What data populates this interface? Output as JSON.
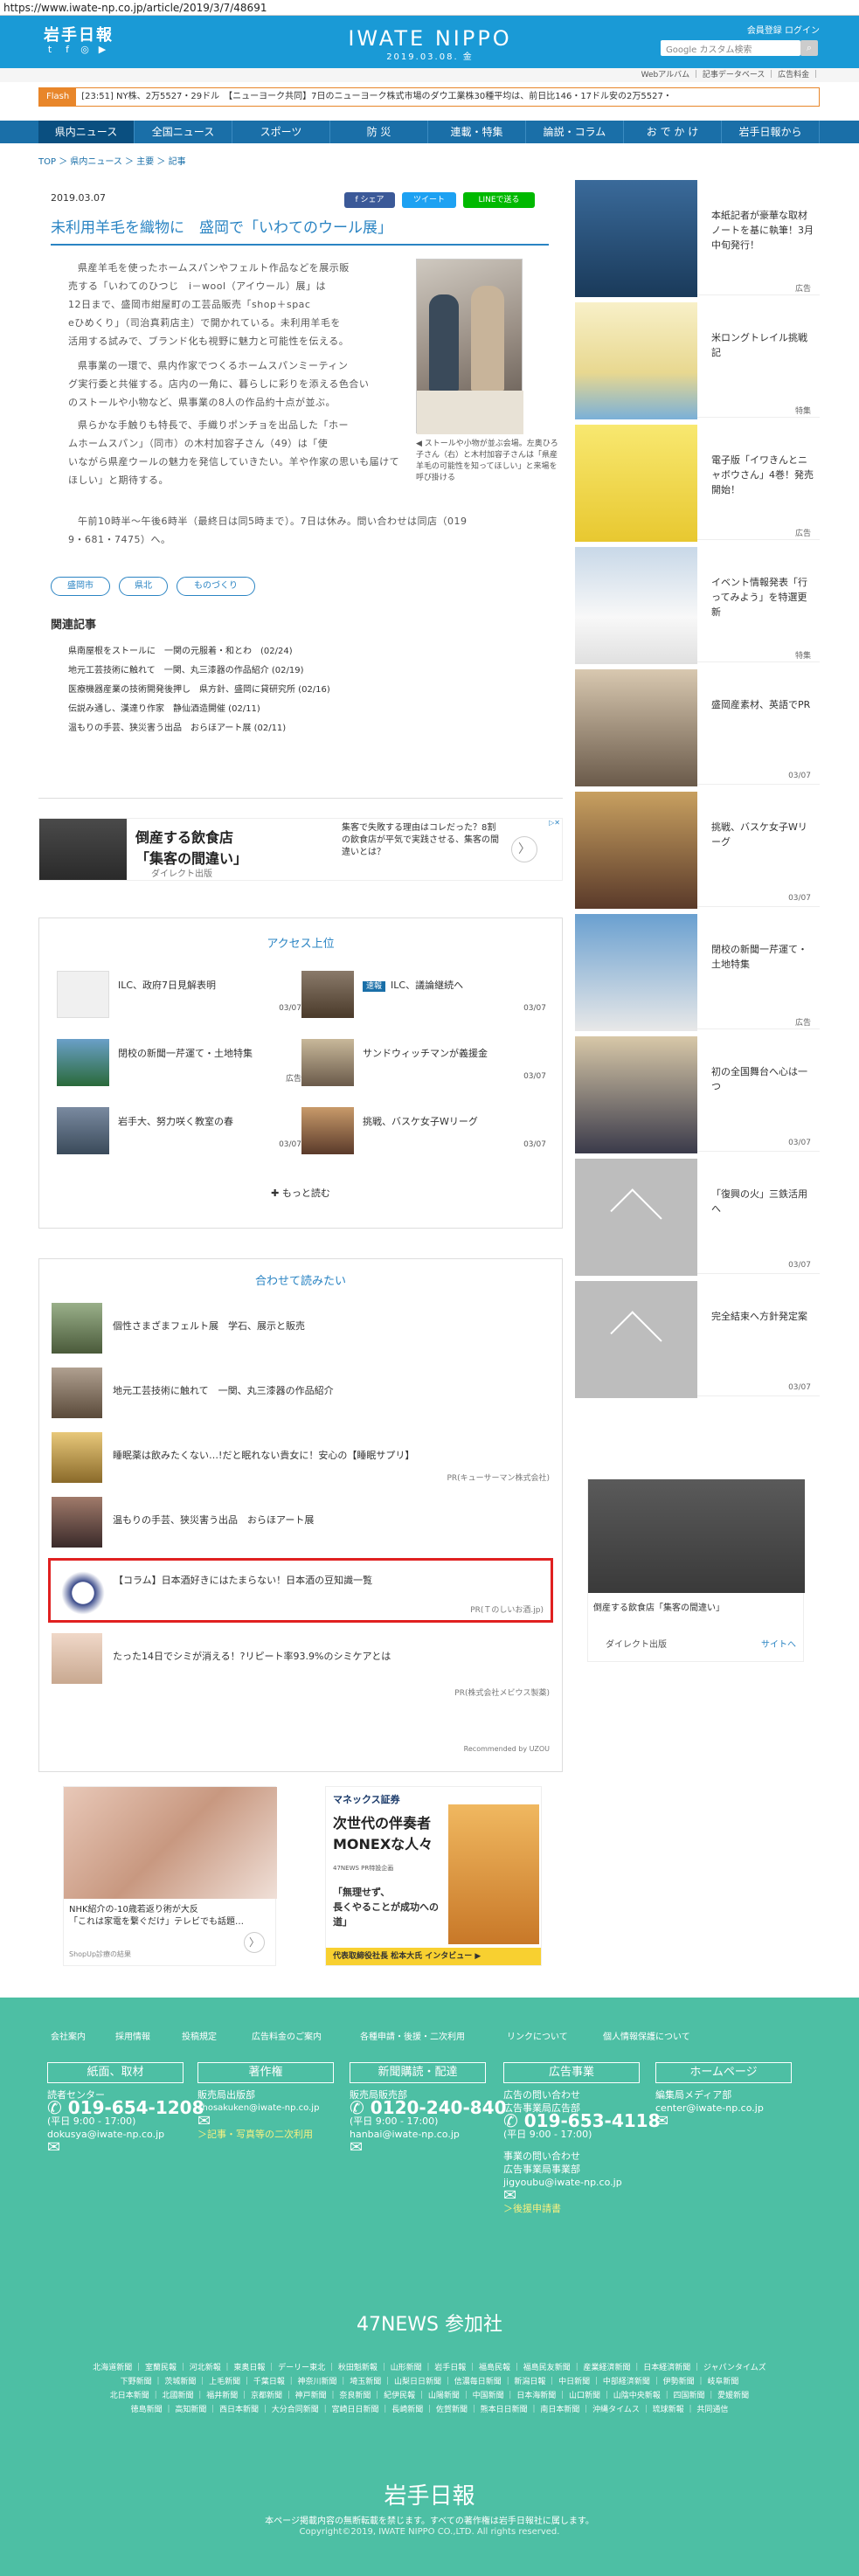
{
  "url": "https://www.iwate-np.co.jp/article/2019/3/7/48691",
  "header": {
    "logo": "岩手日報",
    "brand": "IWATE NIPPO",
    "date": "2019.03.08. 金",
    "member_links": "会員登録 ログイン",
    "search_placeholder": "Google カスタム検索",
    "search_icon": "search-icon",
    "sub_links": "Webアルバム ｜ 記事データベース ｜ 広告料金 ｜"
  },
  "flash": {
    "tag": "Flash",
    "text": "[23:51] NY株、2万5527・29ドル　【ニューヨーク共同】7日のニューヨーク株式市場のダウ工業株30種平均は、前日比146・17ドル安の2万5527・"
  },
  "nav": [
    "県内ニュース",
    "全国ニュース",
    "スポーツ",
    "防 災",
    "連載・特集",
    "論説・コラム",
    "お で か け",
    "岩手日報から"
  ],
  "breadcrumb": "TOP ＞ 県内ニュース ＞ 主要 ＞ 記事",
  "article": {
    "date": "2019.03.07",
    "share": {
      "facebook": "f シェア",
      "twitter": "ツイート",
      "line": "LINEで送る"
    },
    "title": "未利用羊毛を織物に　盛岡で「いわてのウール展」",
    "p1_lines": [
      "県産羊毛を使ったホームスパンやフェルト作品などを展示販",
      "売する「いわてのひつじ　i－wool（アイウール）展」は",
      "12日まで、盛岡市紺屋町の工芸品販売「shop＋spac",
      "eひめくり」（司治真莉店主）で開かれている。未利用羊毛を",
      "活用する試みで、ブランド化も視野に魅力と可能性を伝える。"
    ],
    "p2_lines": [
      "県事業の一環で、県内作家でつくるホームスパンミーティン",
      "グ実行委と共催する。店内の一角に、暮らしに彩りを添える色合い",
      "のストールや小物など、県事業の8人の作品約十点が並ぶ。"
    ],
    "p3_lines": [
      "県らかな手触りも特長で、手織りポンチョを出品した「ホー",
      "ムホームスパン」（同市）の木村加容子さん（49）は「使",
      "いながら県産ウールの魅力を発信していきたい。羊や作家の思いも届けて",
      "ほしい」と期待する。"
    ],
    "p4_lines": [
      "午前10時半～午後6時半（最終日は同5時まで）。7日は休み。問い合わせは同店（019",
      "9・681・7475）へ。"
    ],
    "caption": "◀ ストールや小物が並ぶ会場。左奥ひろ子さん（右）と木村加容子さんは「県産羊毛の可能性を知ってほしい」と来場を呼び掛ける",
    "tags": [
      "盛岡市",
      "県北",
      "ものづくり"
    ],
    "related_title": "関連記事",
    "related": [
      "県南屋根をストールに　一関の元服着・和とわ　(02/24)",
      "地元工芸技術に触れて　一関、丸三漆器の作品紹介 (02/19)",
      "医療機器産業の技術開発後押し　県方針、盛岡に貸研究所 (02/16)",
      "伝説み通し、漢達り作家　静仙酒造開催 (02/11)",
      "温もりの手芸、狭災害う出品　おらほアート展 (02/11)"
    ]
  },
  "ad_banner": {
    "headline_line1": "倒産する飲食店",
    "headline_line2": "「集客の間違い」",
    "sponsor": "ダイレクト出版",
    "desc": "集客で失敗する理由はコレだった？8割の飲食店が平気で実践させる、集客の間違いとは？",
    "next": "〉",
    "badge": "▷✕"
  },
  "ranking": {
    "title": "アクセス上位",
    "items": [
      {
        "text": "ILC、政府7日見解表明",
        "date": "03/07",
        "badge": ""
      },
      {
        "text": "ILC、議論継続へ",
        "date": "03/07",
        "badge": "速報"
      },
      {
        "text": "閉校の新聞一芹運て・土地特集",
        "date": "",
        "badge": "広告"
      },
      {
        "text": "サンドウィッチマンが義援金",
        "date": "03/07",
        "badge": ""
      },
      {
        "text": "岩手大、努力咲く教室の春",
        "date": "03/07",
        "badge": ""
      },
      {
        "text": "挑戦、バスケ女子Wリーグ",
        "date": "03/07",
        "badge": ""
      }
    ],
    "more": "もっと読む"
  },
  "recommend": {
    "title": "合わせて読みたい",
    "items": [
      {
        "text": "個性さまざまフェルト展　学石、展示と販売",
        "sponsor": ""
      },
      {
        "text": "地元工芸技術に触れて　一関、丸三漆器の作品紹介",
        "sponsor": ""
      },
      {
        "text": "睡眠薬は飲みたくない…!だと眠れない貴女に！安心の【睡眠サプリ】",
        "sponsor": "PR(キューサーマン株式会社)"
      },
      {
        "text": "温もりの手芸、狭災害う出品　おらほアート展",
        "sponsor": ""
      },
      {
        "text": "【コラム】日本酒好きにはたまらない！日本酒の豆知識一覧",
        "sponsor": "PR(Ｔのしいお酒.jp)"
      },
      {
        "text": "たった14日でシミが消える！?リピート率93.9%のシミケアとは",
        "sponsor": "PR(株式会社メビウス製薬)"
      }
    ],
    "footer": "Recommended by UZOU"
  },
  "bottom_ads": {
    "left_text": "NHK紹介の-10歳若返り術が大反\n「これは家電を繋ぐだけ」テレビでも話題…",
    "left_sponsor": "ShopUp診療の結果",
    "right_brand": "マネックス証券",
    "right_title": "次世代の伴奏者\nMONEXな人々",
    "right_sub": "47NEWS PR特設企画",
    "right_quote": "「無理せず、\n長くやることが成功への道」",
    "right_foot": "代表取締役社長 松本大氏 インタビュー ▶"
  },
  "sidebar": [
    {
      "text": "本紙記者が豪華な取材ノートを基に執筆！3月中旬発行！",
      "meta": "広告"
    },
    {
      "text": "米ロングトレイル挑戦記",
      "meta": "特集"
    },
    {
      "text": "電子版「イワきんとニャボウさん」4巻！発売開始！",
      "meta": "広告"
    },
    {
      "text": "イベント情報発表「行ってみよう」を特選更新",
      "meta": "特集"
    },
    {
      "text": "盛岡産素材、英語でPR",
      "meta": "03/07"
    },
    {
      "text": "挑戦、バスケ女子Wリーグ",
      "meta": "03/07"
    },
    {
      "text": "閉校の新聞一芹運て・土地特集",
      "meta": "広告"
    },
    {
      "text": "初の全国舞台へ心は一つ",
      "meta": "03/07"
    },
    {
      "text": "「復興の火」三鉄活用へ",
      "meta": "03/07"
    },
    {
      "text": "完全結束へ方針発定案",
      "meta": "03/07"
    }
  ],
  "sidebar_ad": {
    "caption": "倒産する飲食店「集客の間違い」",
    "sponsor": "ダイレクト出版",
    "site": "サイトへ"
  },
  "footer": {
    "links": [
      "会社案内",
      "採用情報",
      "投稿規定",
      "広告料金のご案内",
      "各種申請・後援・二次利用",
      "リンクについて",
      "個人情報保護について"
    ],
    "boxes": [
      "紙面、取材",
      "著作権",
      "新聞購読・配達",
      "広告事業",
      "ホームページ"
    ],
    "col1": {
      "label": "読者センター",
      "phone": "019-654-1208",
      "hours": "(平日 9:00 - 17:00)",
      "email": "dokusya@iwate-np.co.jp"
    },
    "col2": {
      "label": "販売局出版部",
      "email": "chosakuken@iwate-np.co.jp",
      "link": "＞記事・写真等の二次利用"
    },
    "col3": {
      "label": "販売局販売部",
      "phone": "0120-240-840",
      "hours": "(平日 9:00 - 17:00)",
      "email": "hanbai@iwate-np.co.jp"
    },
    "col4": {
      "label1": "広告の問い合わせ",
      "label2": "広告事業局広告部",
      "phone": "019-653-4118",
      "hours": "(平日 9:00 - 17:00)",
      "label3": "事業の問い合わせ",
      "label4": "広告事業局事業部",
      "email": "jigyoubu@iwate-np.co.jp",
      "link": "＞後援申請書"
    },
    "col5": {
      "label": "編集局メディア部",
      "email": "center@iwate-np.co.jp"
    },
    "news47": "47NEWS 参加社",
    "news_lines": [
      "北海道新聞 ｜ 室蘭民報 ｜ 河北新報 ｜ 東奥日報 ｜ デーリー東北 ｜ 秋田魁新報 ｜ 山形新聞 ｜ 岩手日報 ｜ 福島民報 ｜ 福島民友新聞 ｜ 産業経済新聞 ｜ 日本経済新聞 ｜ ジャパンタイムズ",
      "下野新聞 ｜ 茨城新聞 ｜ 上毛新聞 ｜ 千葉日報 ｜ 神奈川新聞 ｜ 埼玉新聞 ｜ 山梨日日新聞 ｜ 信濃毎日新聞 ｜ 新潟日報 ｜ 中日新聞 ｜ 中部経済新聞 ｜ 伊勢新聞 ｜ 岐阜新聞",
      "北日本新聞 ｜ 北國新聞 ｜ 福井新聞 ｜ 京都新聞 ｜ 神戸新聞 ｜ 奈良新聞 ｜ 紀伊民報 ｜ 山陽新聞 ｜ 中国新聞 ｜ 日本海新聞 ｜ 山口新聞 ｜ 山陰中央新報 ｜ 四国新聞 ｜ 愛媛新聞",
      "徳島新聞 ｜ 高知新聞 ｜ 西日本新聞 ｜ 大分合同新聞 ｜ 宮崎日日新聞 ｜ 長崎新聞 ｜ 佐賀新聞 ｜ 熊本日日新聞 ｜ 南日本新聞 ｜ 沖縄タイムス ｜ 琉球新報 ｜ 共同通信"
    ],
    "logo": "岩手日報",
    "note": "本ページ掲載内容の無断転載を禁じます。すべての著作権は岩手日報社に属します。",
    "copyright": "Copyright©2019, IWATE NIPPO CO.,LTD. All rights reserved."
  }
}
